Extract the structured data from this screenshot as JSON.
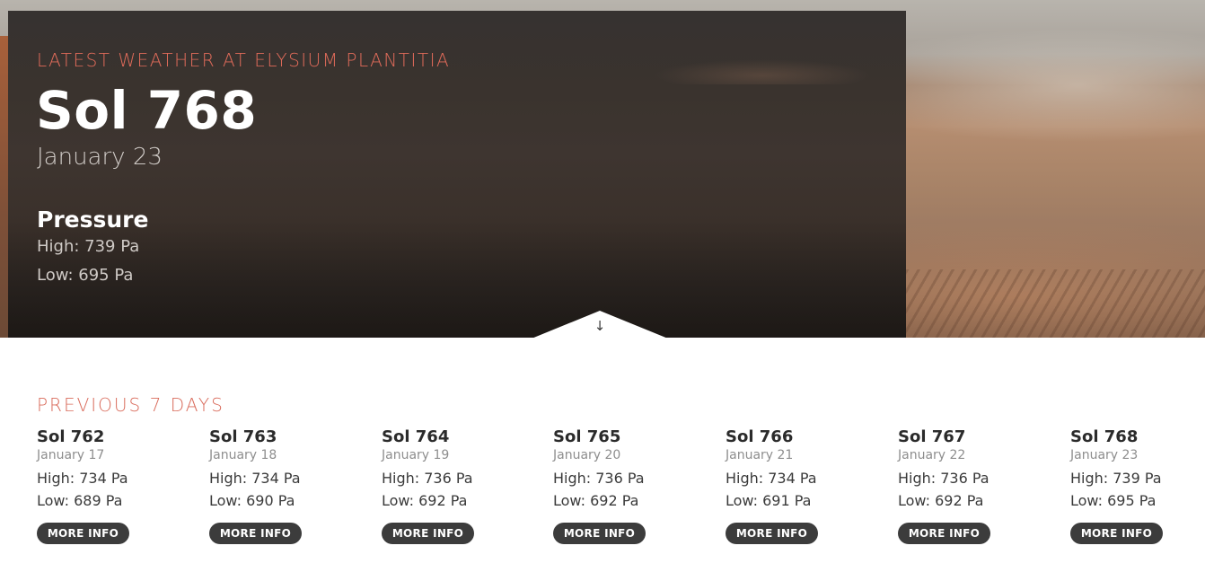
{
  "current": {
    "heading": "LATEST WEATHER AT ELYSIUM PLANTITIA",
    "sol": "Sol 768",
    "date": "January 23",
    "pressure_heading": "Pressure",
    "high": "High: 739 Pa",
    "low": "Low: 695 Pa"
  },
  "toggle": {
    "icon": "arrow-down-icon",
    "glyph": "↓"
  },
  "previous": {
    "heading": "PREVIOUS 7 DAYS",
    "button_label": "MORE INFO",
    "days": [
      {
        "sol": "Sol 762",
        "date": "January 17",
        "high": "High: 734 Pa",
        "low": "Low: 689 Pa"
      },
      {
        "sol": "Sol 763",
        "date": "January 18",
        "high": "High: 734 Pa",
        "low": "Low: 690 Pa"
      },
      {
        "sol": "Sol 764",
        "date": "January 19",
        "high": "High: 736 Pa",
        "low": "Low: 692 Pa"
      },
      {
        "sol": "Sol 765",
        "date": "January 20",
        "high": "High: 736 Pa",
        "low": "Low: 692 Pa"
      },
      {
        "sol": "Sol 766",
        "date": "January 21",
        "high": "High: 734 Pa",
        "low": "Low: 691 Pa"
      },
      {
        "sol": "Sol 767",
        "date": "January 22",
        "high": "High: 736 Pa",
        "low": "Low: 692 Pa"
      },
      {
        "sol": "Sol 768",
        "date": "January 23",
        "high": "High: 739 Pa",
        "low": "Low: 695 Pa"
      }
    ]
  },
  "colors": {
    "accent": "#e06b5a",
    "panel": "#363230",
    "button": "#3c3c3c"
  }
}
